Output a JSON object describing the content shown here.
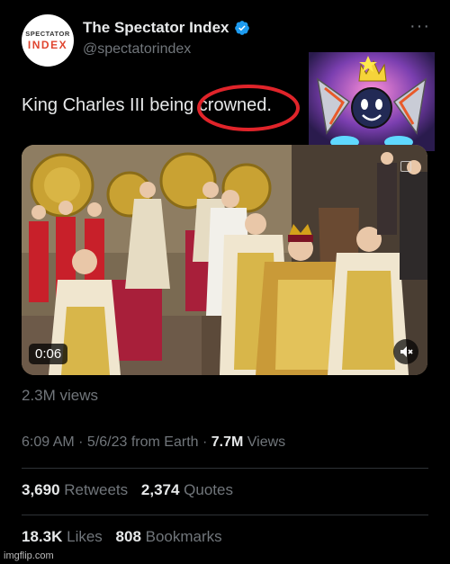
{
  "author": {
    "avatar_line1": "SPECTATOR",
    "avatar_line2": "INDEX",
    "display_name": "The Spectator Index",
    "handle": "@spectatorindex"
  },
  "tweet": {
    "text_before": "King Charles III being ",
    "text_highlight": "crowned."
  },
  "media": {
    "duration": "0:06"
  },
  "views_line": "2.3M views",
  "meta": {
    "time": "6:09 AM",
    "sep1": " · ",
    "date": "5/6/23",
    "source": " from Earth",
    "sep2": " · ",
    "views_count": "7.7M",
    "views_label": " Views"
  },
  "stats": {
    "retweets_count": "3,690",
    "retweets_label": "Retweets",
    "quotes_count": "2,374",
    "quotes_label": "Quotes",
    "likes_count": "18.3K",
    "likes_label": "Likes",
    "bookmarks_count": "808",
    "bookmarks_label": "Bookmarks"
  },
  "watermark": "imgflip.com",
  "colors": {
    "background": "#000000",
    "text": "#e7e9ea",
    "muted": "#71767b",
    "verified": "#1d9bf0",
    "annotation_red": "#e0242a"
  },
  "icons": [
    "verified-badge-icon",
    "more-icon",
    "mute-icon",
    "captions-icon"
  ]
}
